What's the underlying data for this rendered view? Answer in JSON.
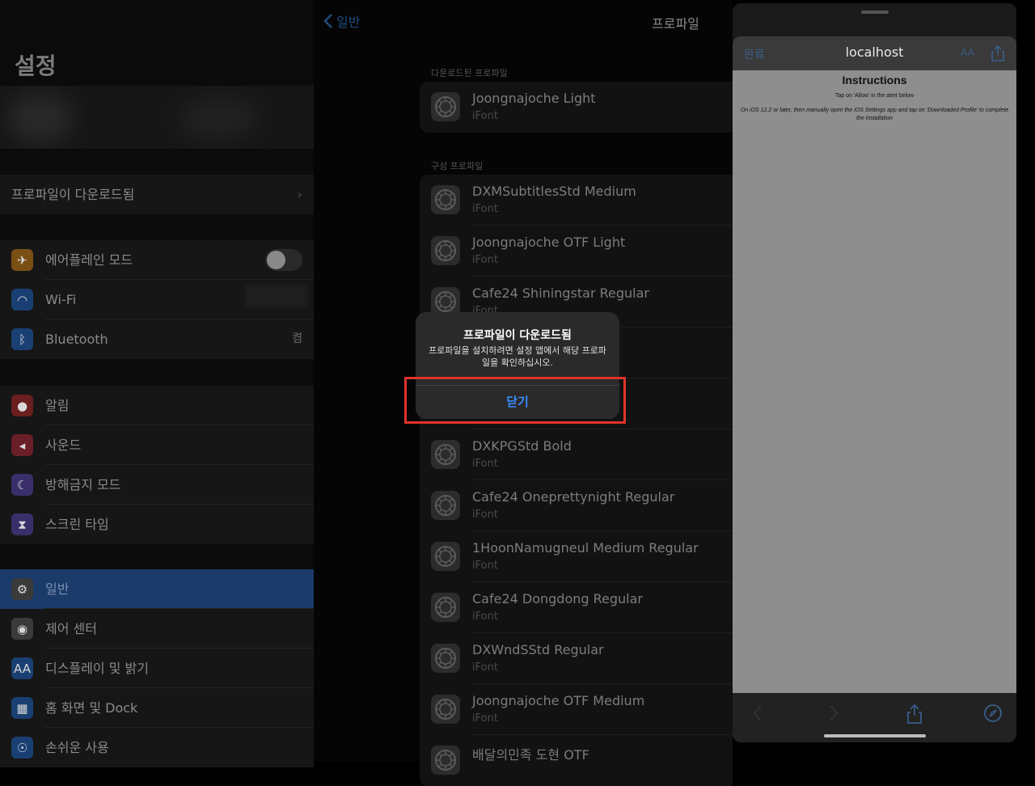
{
  "sidebar": {
    "title": "설정",
    "downloaded_profile_row": "프로파일이 다운로드됨",
    "connectivity": [
      {
        "icon": "airplane-icon",
        "label": "에어플레인 모드",
        "color": "#7a4f14"
      },
      {
        "icon": "wifi-icon",
        "label": "Wi-Fi",
        "color": "#1a3f73"
      },
      {
        "icon": "bluetooth-icon",
        "label": "Bluetooth",
        "value": "켬",
        "color": "#1a3f73"
      }
    ],
    "notifications": [
      {
        "icon": "notifications-icon",
        "label": "알림",
        "color": "#6a1e1e"
      },
      {
        "icon": "sounds-icon",
        "label": "사운드",
        "color": "#6a1e28"
      },
      {
        "icon": "moon-icon",
        "label": "방해금지 모드",
        "color": "#3a2f6a"
      },
      {
        "icon": "hourglass-icon",
        "label": "스크린 타임",
        "color": "#3a2f6a"
      }
    ],
    "general": [
      {
        "icon": "gear-icon",
        "label": "일반",
        "color": "#3a3a3a",
        "selected": true
      },
      {
        "icon": "control-center-icon",
        "label": "제어 센터",
        "color": "#3a3a3a"
      },
      {
        "icon": "display-icon",
        "label": "디스플레이 및 밝기",
        "color": "#1a3f73"
      },
      {
        "icon": "home-screen-icon",
        "label": "홈 화면 및 Dock",
        "color": "#1a3f73"
      },
      {
        "icon": "accessibility-icon",
        "label": "손쉬운 사용",
        "color": "#1a3f73"
      }
    ]
  },
  "main": {
    "back_label": "일반",
    "title": "프로파일",
    "downloaded_header": "다운로드된 프로파일",
    "downloaded": [
      {
        "name": "Joongnajoche Light",
        "sub": "iFont"
      }
    ],
    "config_header": "구성 프로파일",
    "profiles": [
      {
        "name": "DXMSubtitlesStd Medium",
        "sub": "iFont"
      },
      {
        "name": "Joongnajoche OTF Light",
        "sub": "iFont"
      },
      {
        "name": "Cafe24 Shiningstar Regular",
        "sub": "iFont"
      },
      {
        "name": "",
        "sub": ""
      },
      {
        "name": "",
        "sub": ""
      },
      {
        "name": "DXKPGStd Bold",
        "sub": "iFont"
      },
      {
        "name": "Cafe24 Oneprettynight Regular",
        "sub": "iFont"
      },
      {
        "name": "1HoonNamugneul Medium Regular",
        "sub": "iFont"
      },
      {
        "name": "Cafe24 Dongdong Regular",
        "sub": "iFont"
      },
      {
        "name": "DXWndSStd Regular",
        "sub": "iFont"
      },
      {
        "name": "Joongnajoche OTF Medium",
        "sub": "iFont"
      },
      {
        "name": "배달의민족 도현 OTF",
        "sub": ""
      }
    ]
  },
  "alert": {
    "title": "프로파일이 다운로드됨",
    "message": "프로파일을 설치하려면 설정 앱에서 해당 프로파일을 확인하십시오.",
    "button": "닫기"
  },
  "browser": {
    "done": "완료",
    "url": "localhost",
    "aa": "AA",
    "heading": "Instructions",
    "line1": "Tap on 'Allow' in the alert below",
    "line2": "On iOS 12.2 or later, then manually open the iOS Settings app and tap on 'Downloaded Profile' to complete the installation"
  },
  "colors": {
    "accent": "#3a8cff",
    "highlight": "#e0332a"
  }
}
